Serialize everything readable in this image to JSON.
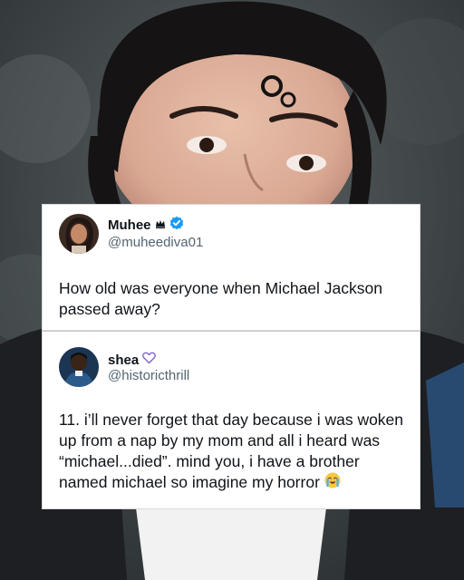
{
  "colors": {
    "card_bg": "#ffffff",
    "text": "#0f1419",
    "handle": "#536471",
    "verified": "#1d9bf0"
  },
  "tweet": {
    "name": "Muhee",
    "badge_icon": "crown-icon",
    "verified_icon": "verified-icon",
    "handle": "@muheediva01",
    "text": "How old was everyone when Michael Jackson passed away?"
  },
  "reply": {
    "name": "shea",
    "badge_icon": "heart-icon",
    "handle": "@historicthrill",
    "text": "11. i’ll never forget that day because i was woken up from a nap by my mom and all i heard was “michael...died”. mind you, i have a brother named michael so imagine my horror",
    "emoji_icon": "crying-emoji-icon"
  }
}
